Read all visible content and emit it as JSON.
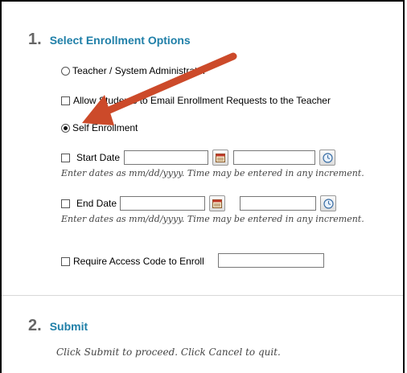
{
  "section1": {
    "number": "1.",
    "title": "Select Enrollment Options",
    "option_teacher": "Teacher / System Administrator",
    "option_allow_email": "Allow Students to Email Enrollment Requests to the Teacher",
    "option_self": "Self Enrollment",
    "start_date_label": "Start Date",
    "end_date_label": "End Date",
    "date_hint": "Enter dates as mm/dd/yyyy. Time may be entered in any increment.",
    "access_code_label": "Require Access Code to Enroll",
    "selected_option": "Self Enrollment"
  },
  "section2": {
    "number": "2.",
    "title": "Submit",
    "hint": "Click Submit to proceed. Click Cancel to quit."
  },
  "icons": {
    "calendar": "calendar-icon",
    "clock": "clock-icon"
  },
  "colors": {
    "accent": "#1f7fa8",
    "arrow": "#cc4a2a"
  }
}
